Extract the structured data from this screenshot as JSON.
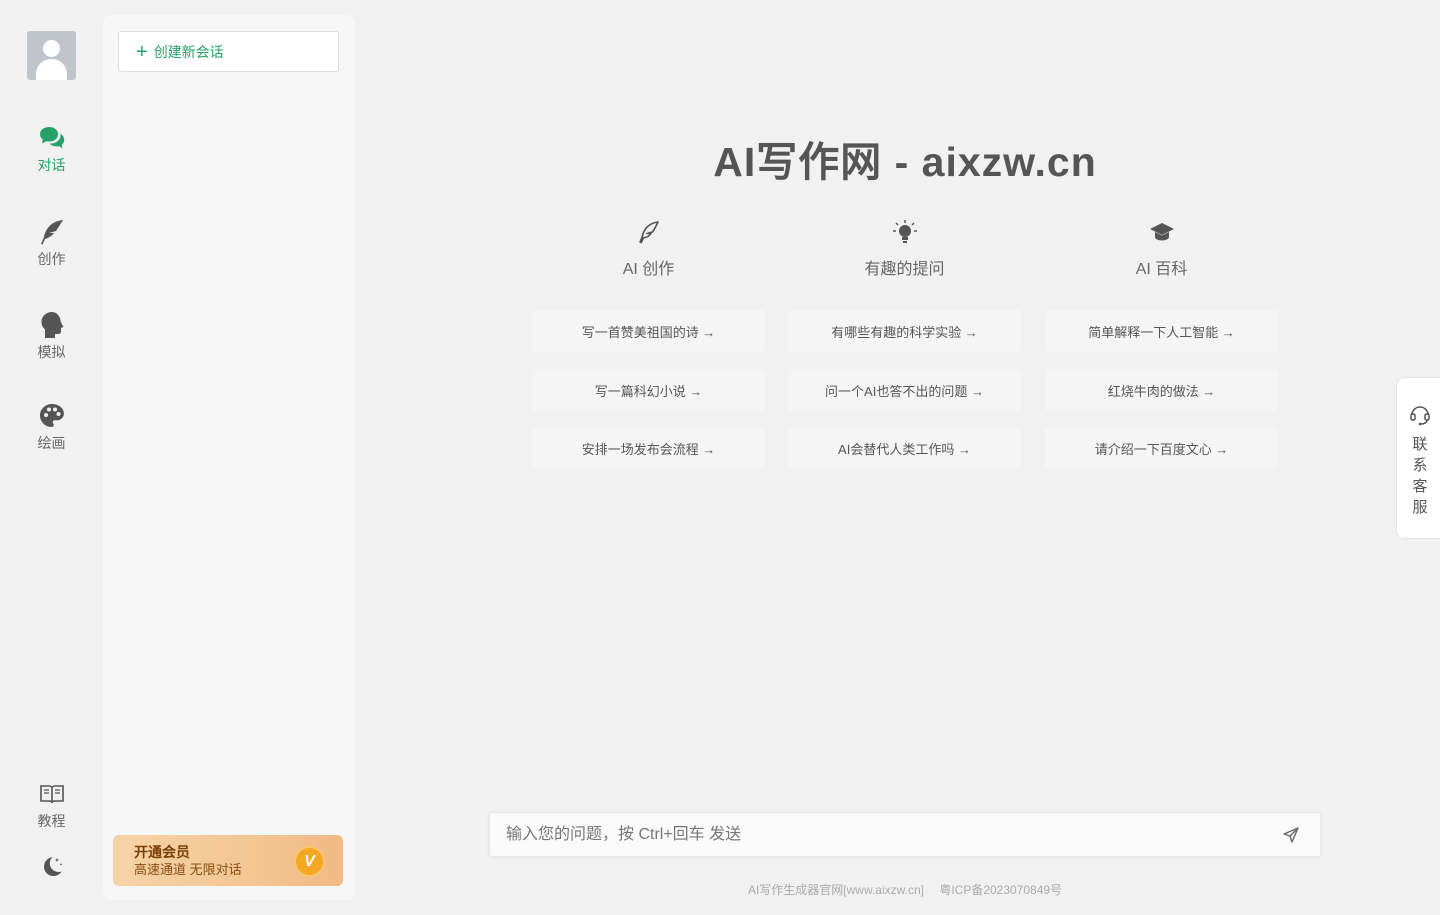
{
  "colors": {
    "accent": "#26a269",
    "vip_text": "#7a3f05"
  },
  "rail": {
    "items": [
      {
        "label": "对话",
        "icon": "chat-bubbles-icon",
        "active": true
      },
      {
        "label": "创作",
        "icon": "feather-icon"
      },
      {
        "label": "模拟",
        "icon": "head-profile-icon"
      },
      {
        "label": "绘画",
        "icon": "palette-icon"
      }
    ],
    "bottom": [
      {
        "label": "教程",
        "icon": "book-icon"
      },
      {
        "icon": "moon-icon"
      }
    ]
  },
  "panel": {
    "new_chat_label": "创建新会话",
    "vip_title": "开通会员",
    "vip_sub": "高速通道 无限对话",
    "vip_badge": "V"
  },
  "main": {
    "title": "AI写作网 - aixzw.cn",
    "columns": [
      {
        "label": "AI 创作",
        "icon": "quill-icon",
        "prompts": [
          "写一首赞美祖国的诗 →",
          "写一篇科幻小说 →",
          "安排一场发布会流程 →"
        ]
      },
      {
        "label": "有趣的提问",
        "icon": "lightbulb-icon",
        "prompts": [
          "有哪些有趣的科学实验 →",
          "问一个AI也答不出的问题 →",
          "AI会替代人类工作吗 →"
        ]
      },
      {
        "label": "AI 百科",
        "icon": "graduation-cap-icon",
        "prompts": [
          "简单解释一下人工智能 →",
          "红烧牛肉的做法 →",
          "请介绍一下百度文心 →"
        ]
      }
    ]
  },
  "contact": {
    "label": "联系客服"
  },
  "input": {
    "placeholder": "输入您的问题，按 Ctrl+回车 发送"
  },
  "footer": {
    "site": "AI写作生成器官网[www.aixzw.cn]",
    "icp": "粤ICP备2023070849号"
  }
}
